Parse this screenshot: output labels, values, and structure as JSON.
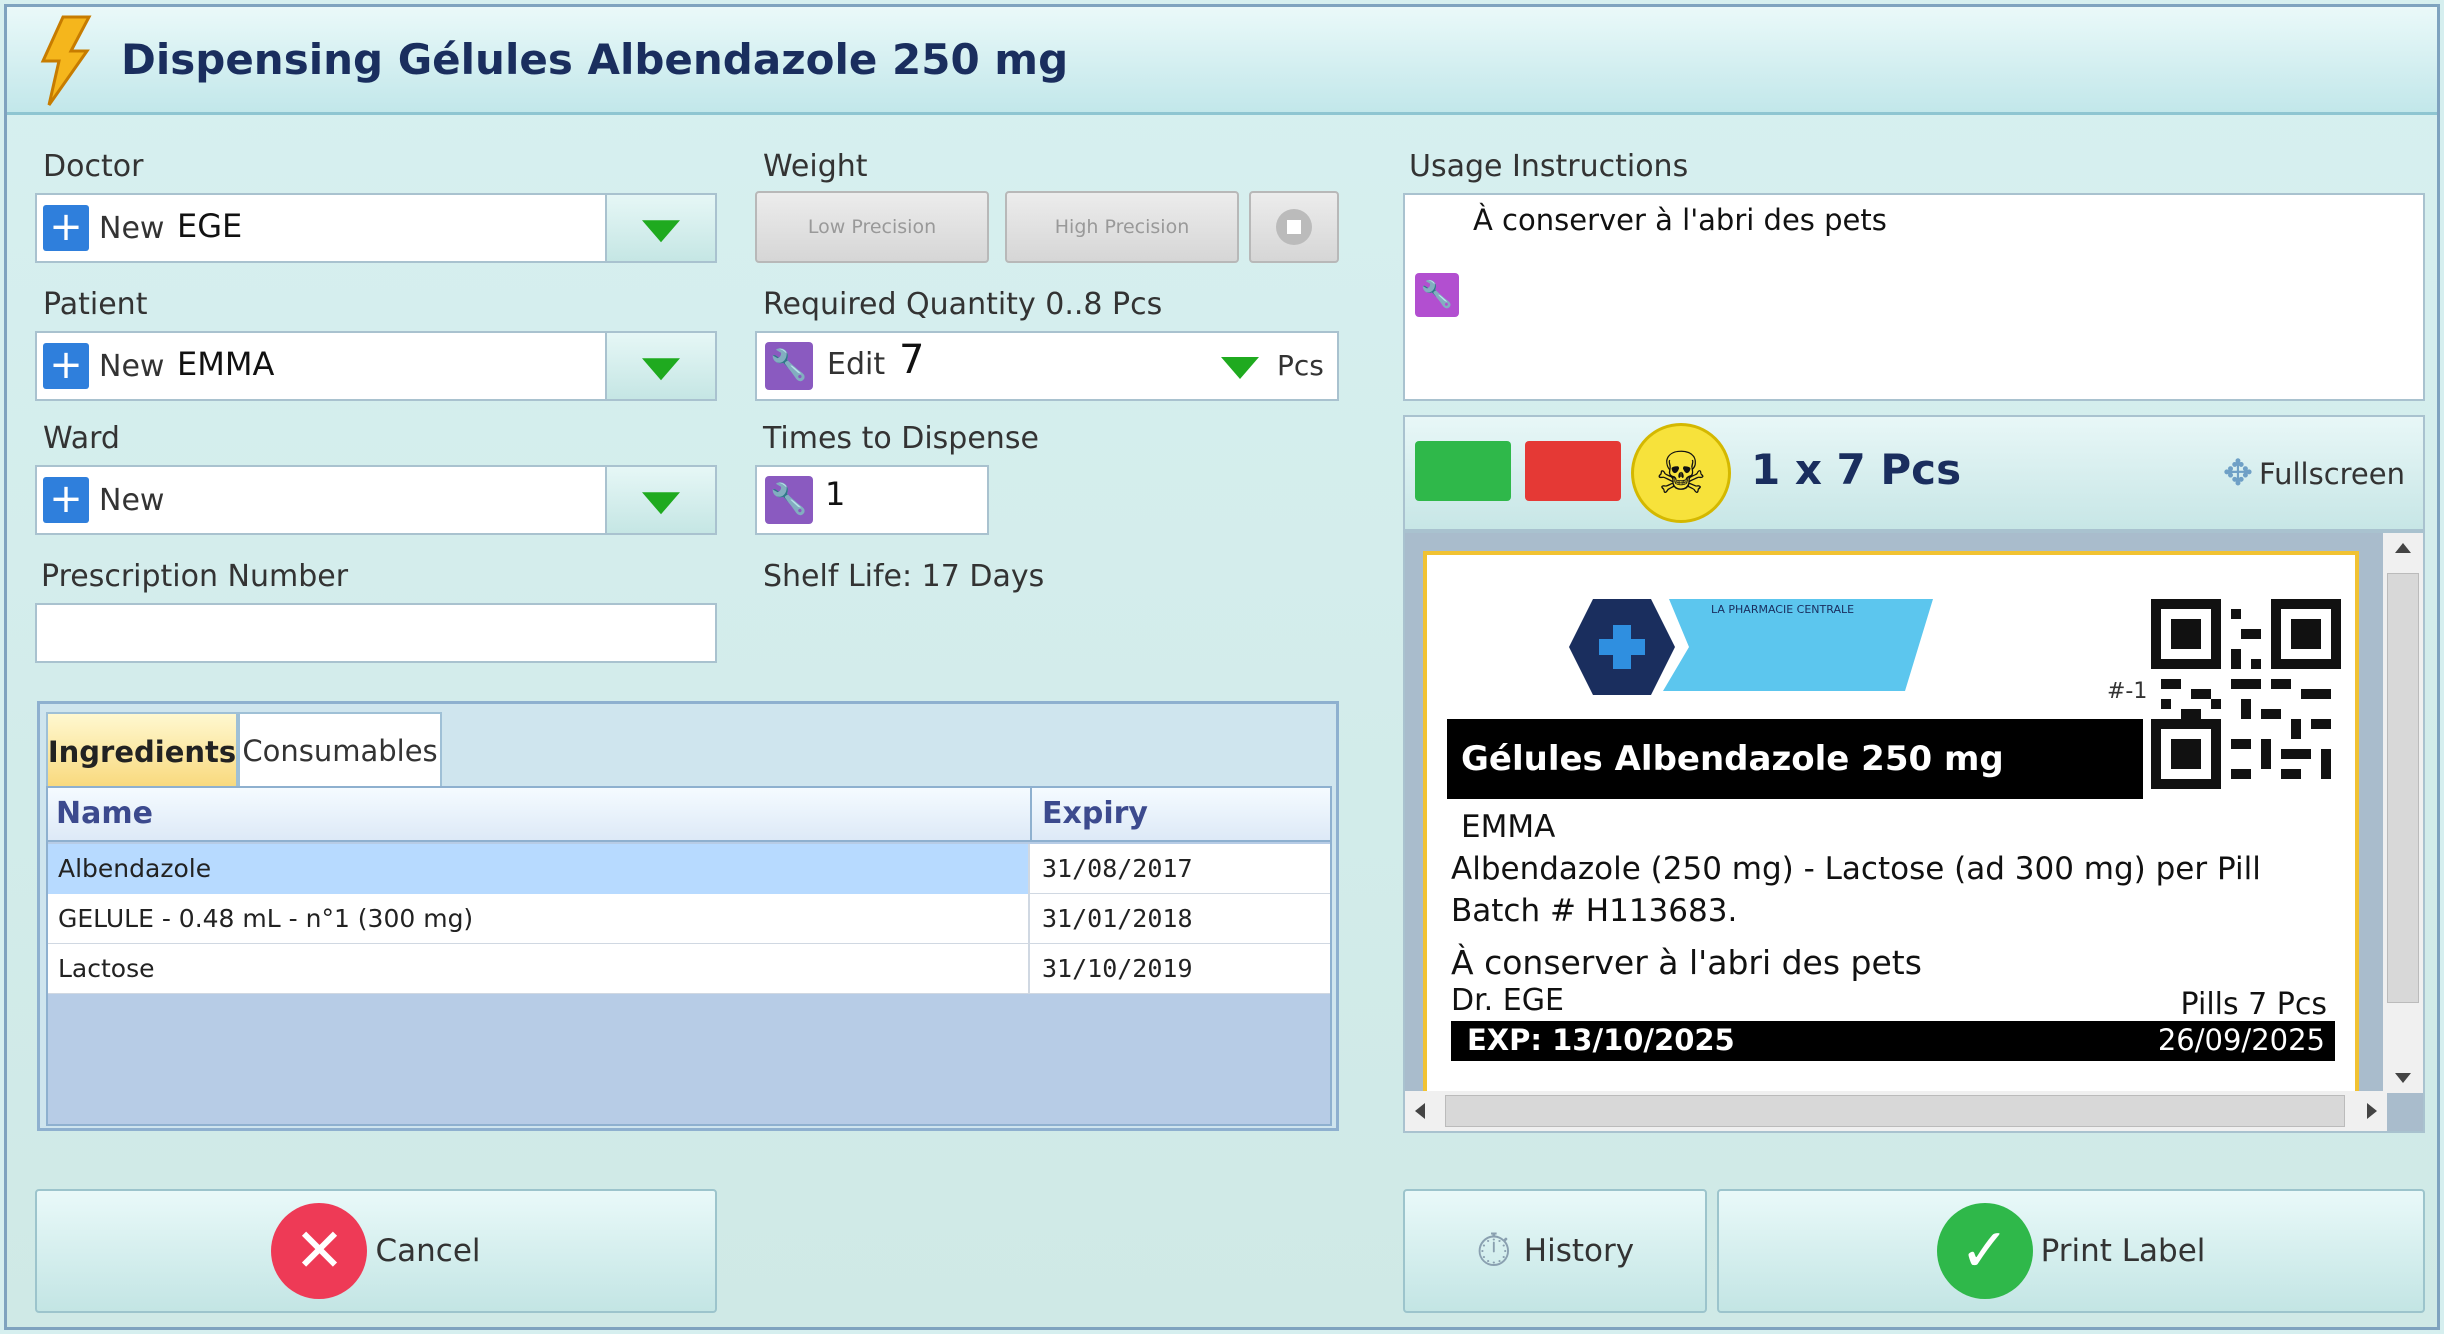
{
  "window": {
    "title": "Dispensing Gélules Albendazole 250 mg"
  },
  "doctor": {
    "label": "Doctor",
    "new_label": "New",
    "value": "EGE"
  },
  "patient": {
    "label": "Patient",
    "new_label": "New",
    "value": "EMMA"
  },
  "ward": {
    "label": "Ward",
    "new_label": "New",
    "value": ""
  },
  "prescription": {
    "label": "Prescription Number",
    "value": ""
  },
  "weight": {
    "label": "Weight",
    "low_precision": "Low Precision",
    "high_precision": "High Precision"
  },
  "quantity": {
    "label": "Required Quantity 0..8 Pcs",
    "edit_label": "Edit",
    "value": "7",
    "unit": "Pcs"
  },
  "times": {
    "label": "Times to Dispense",
    "value": "1"
  },
  "shelf_life": "Shelf Life: 17 Days",
  "usage": {
    "label": "Usage Instructions",
    "text": "À conserver à l'abri des pets"
  },
  "tabs": [
    {
      "label": "Ingredients",
      "active": true
    },
    {
      "label": "Consumables",
      "active": false
    }
  ],
  "ingredients": {
    "columns": [
      "Name",
      "Expiry"
    ],
    "rows": [
      {
        "name": "Albendazole",
        "expiry": "31/08/2017"
      },
      {
        "name": "GELULE  - 0.48 mL - n°1 (300 mg)",
        "expiry": "31/01/2018"
      },
      {
        "name": "Lactose",
        "expiry": "31/10/2019"
      }
    ]
  },
  "preview": {
    "count": "1 x 7 Pcs",
    "fullscreen": "Fullscreen",
    "colors": {
      "green": "#2fb84a",
      "red": "#e53935"
    }
  },
  "label_card": {
    "pharmacy": "LA PHARMACIE CENTRALE",
    "code": "#-1",
    "product": "Gélules Albendazole 250 mg",
    "patient": "EMMA",
    "composition": "Albendazole (250 mg) - Lactose (ad 300 mg) per Pill",
    "batch": "Batch # H113683.",
    "instruction": "À conserver à l'abri des pets",
    "doctor": "Dr. EGE",
    "pills": "Pills 7 Pcs",
    "exp": "EXP: 13/10/2025",
    "date": "26/09/2025"
  },
  "buttons": {
    "cancel": "Cancel",
    "history": "History",
    "print": "Print Label"
  }
}
